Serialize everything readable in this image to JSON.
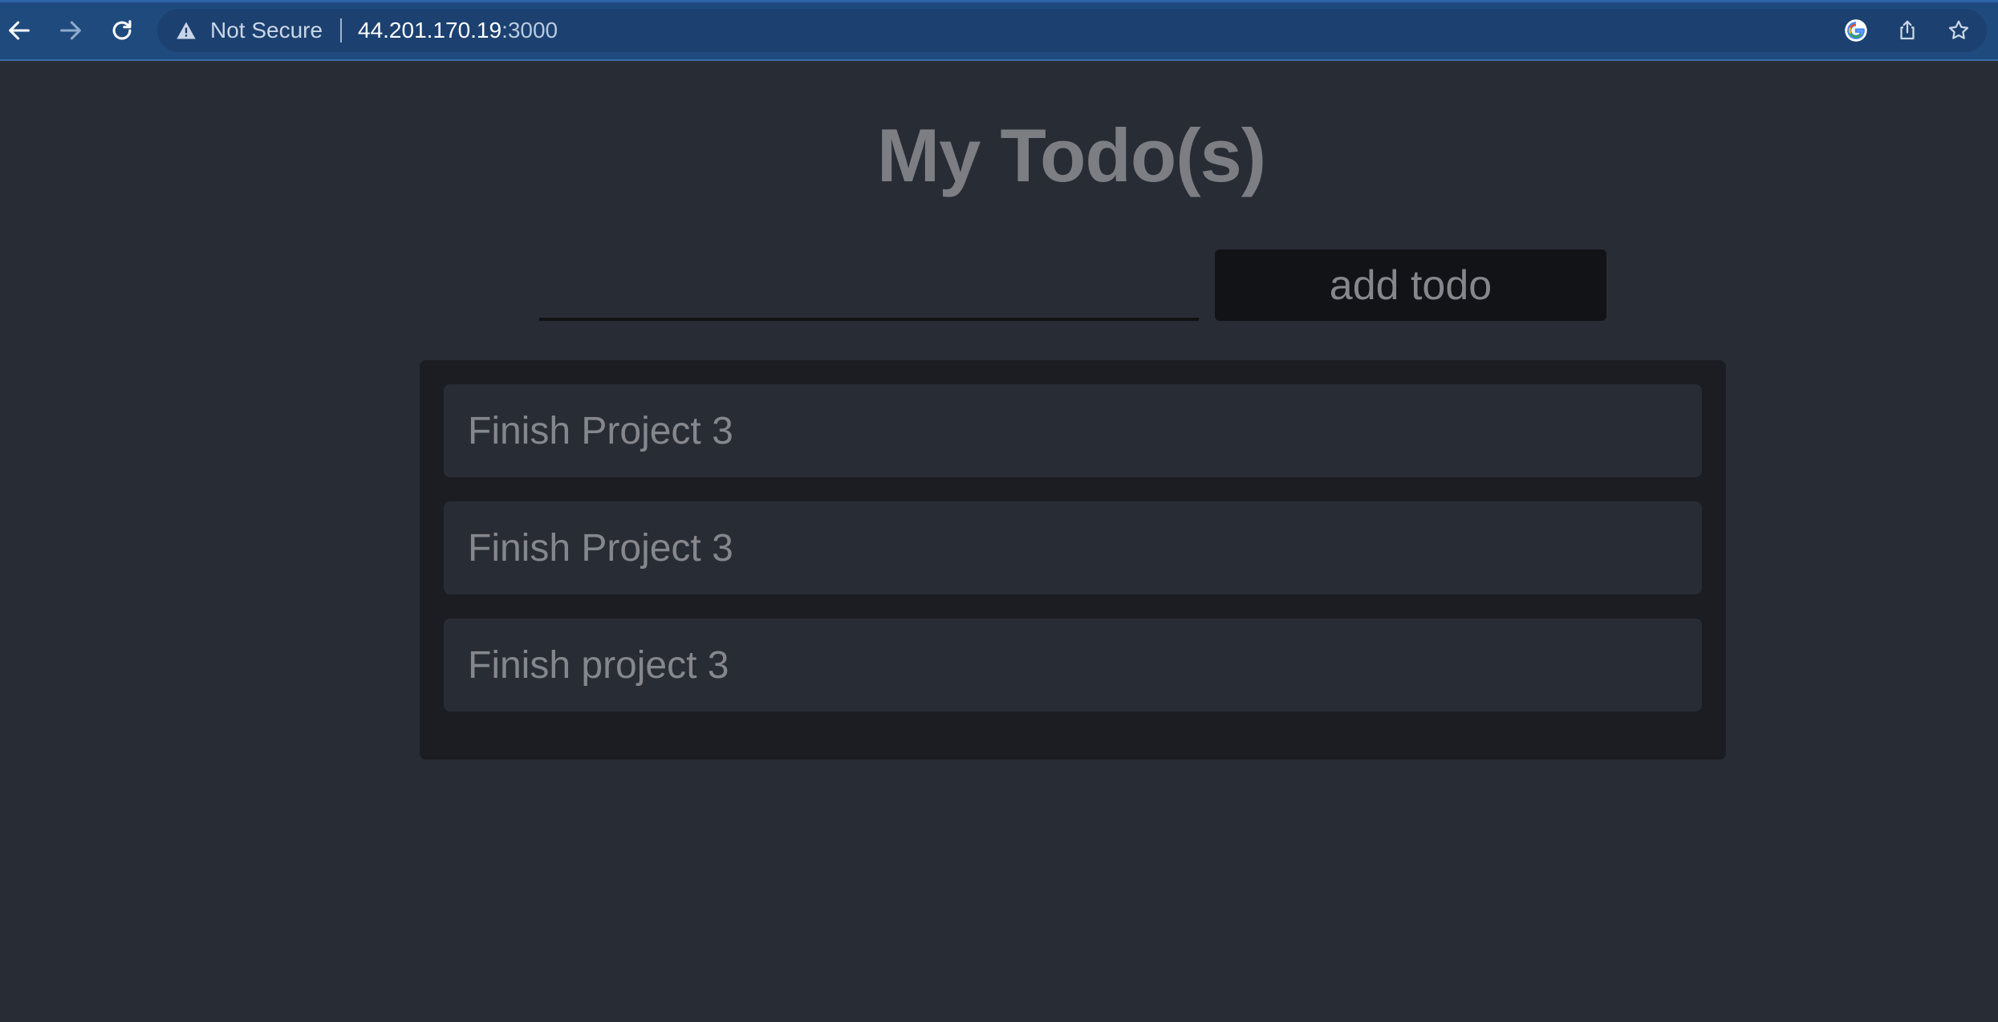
{
  "browser": {
    "security_label": "Not Secure",
    "url_host": "44.201.170.19",
    "url_port": ":3000",
    "icons": [
      "back-icon",
      "forward-icon",
      "reload-icon",
      "warning-icon",
      "google-icon",
      "share-icon",
      "bookmark-star-icon"
    ]
  },
  "page": {
    "title": "My Todo(s)",
    "input_value": "",
    "add_button_label": "add todo",
    "todos": [
      "Finish Project 3",
      "Finish Project 3",
      "Finish project 3"
    ]
  },
  "colors": {
    "chrome": "#1f4a7e",
    "page_background": "#282c35",
    "panel": "#1b1d22",
    "text": "#85878c"
  }
}
